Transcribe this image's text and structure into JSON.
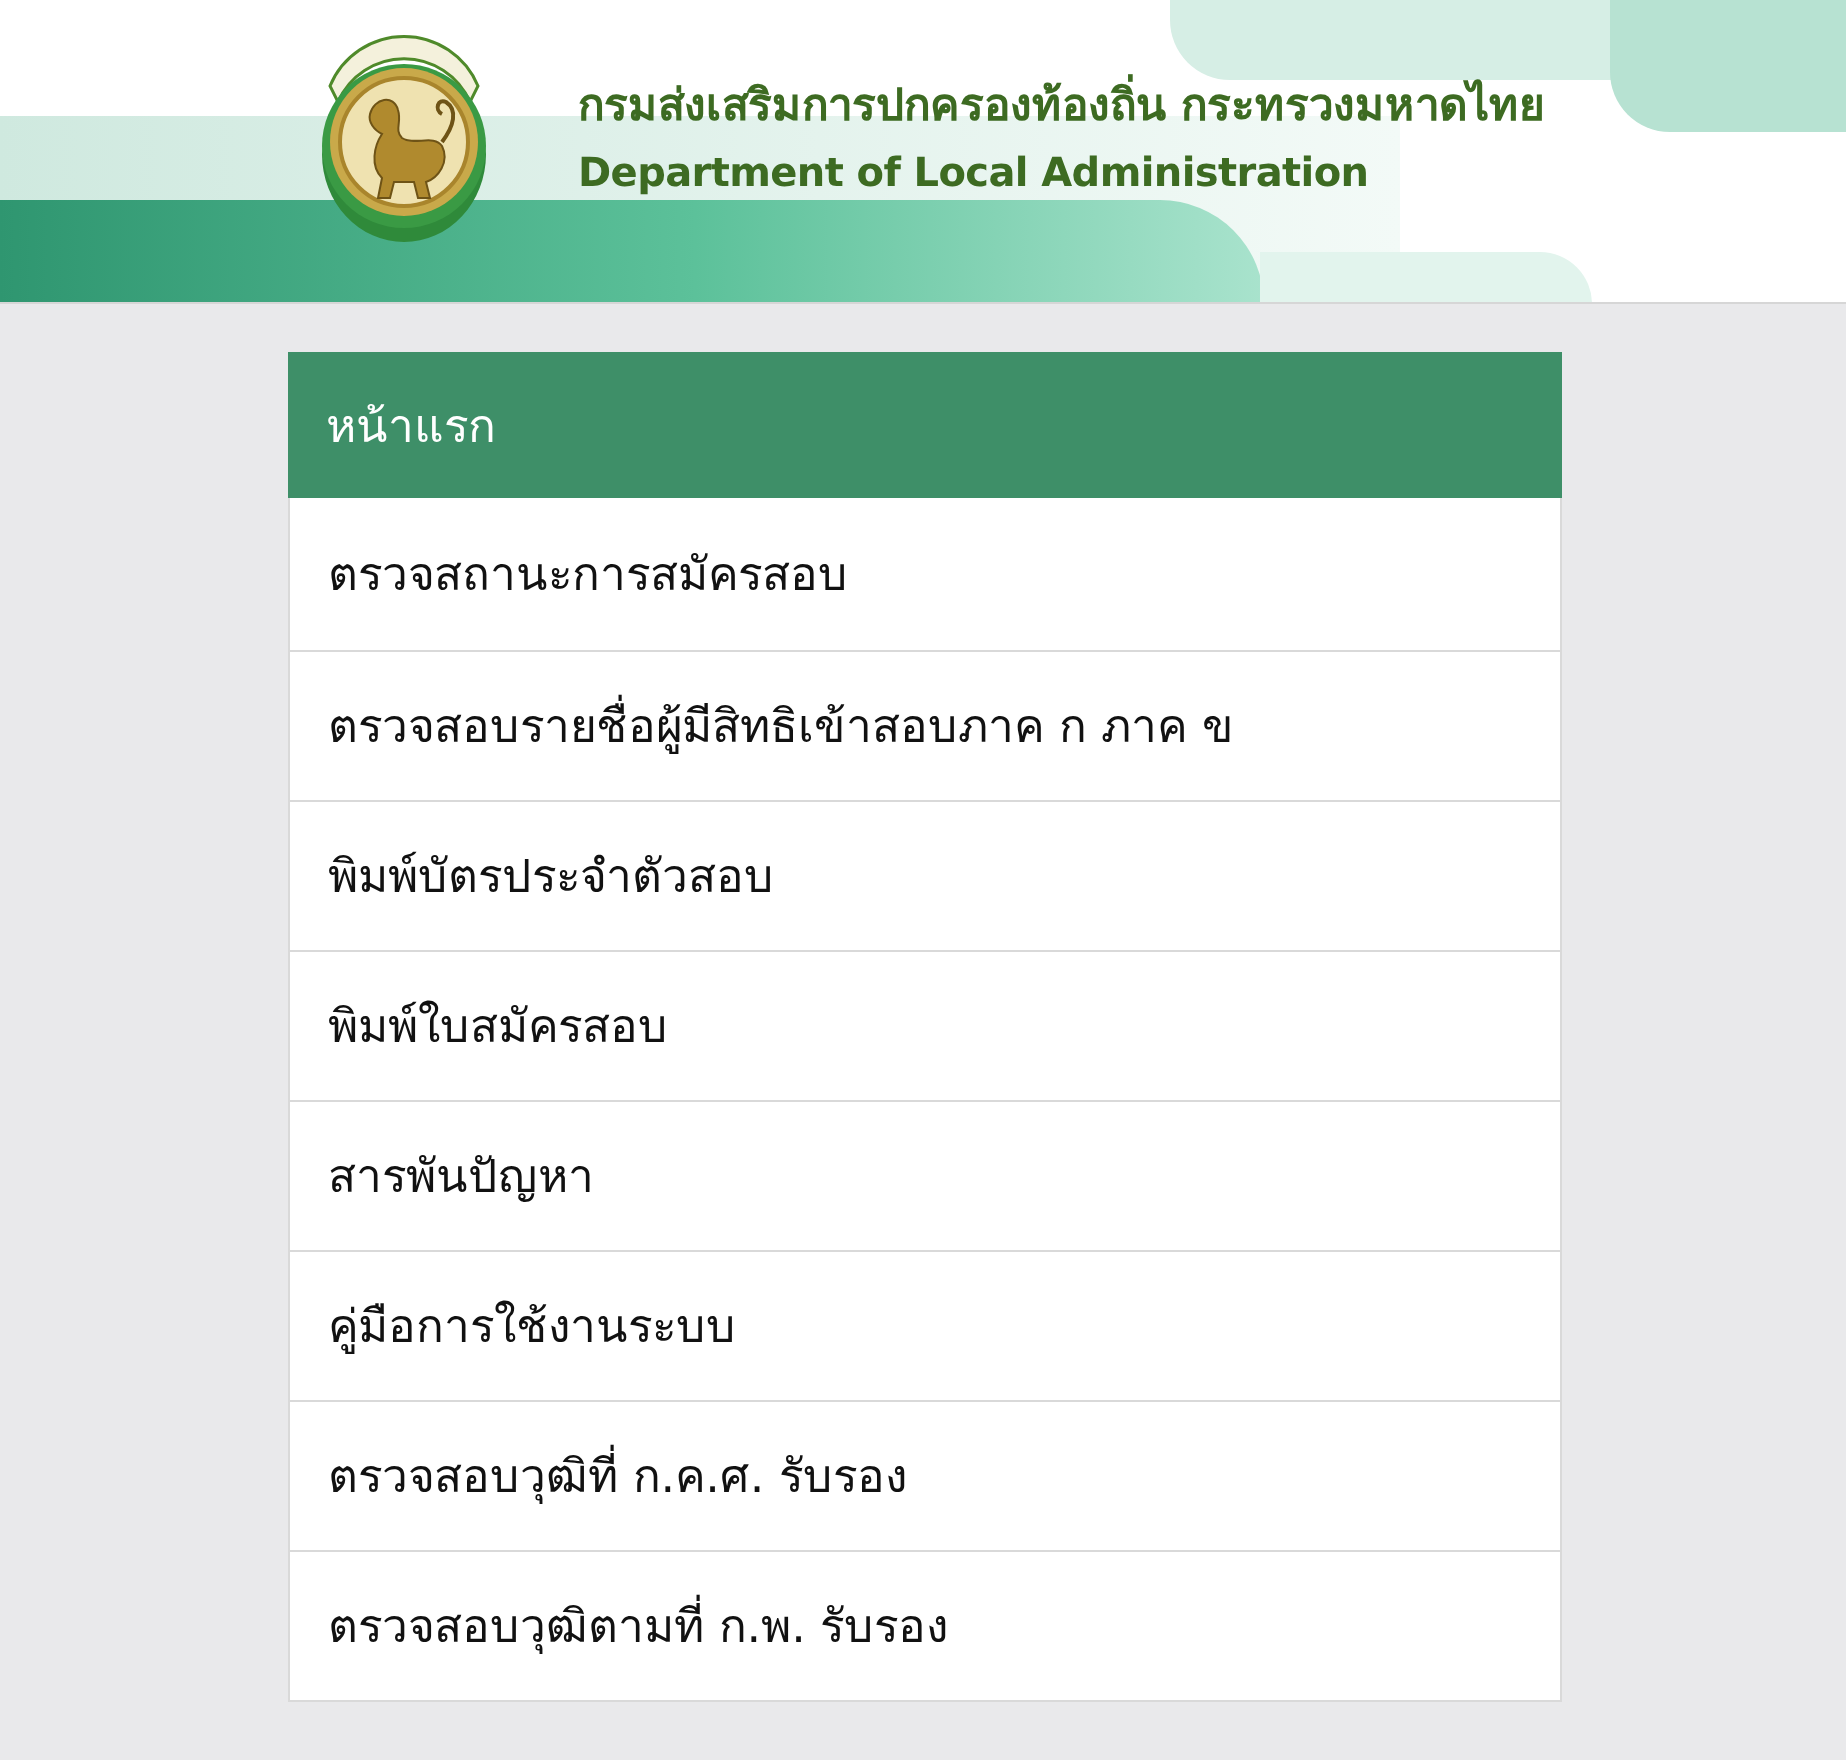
{
  "header": {
    "title_th": "กรมส่งเสริมการปกครองท้องถิ่น กระทรวงมหาดไทย",
    "title_en": "Department of Local Administration"
  },
  "menu": {
    "heading": "หน้าแรก",
    "items": [
      "ตรวจสถานะการสมัครสอบ",
      "ตรวจสอบรายชื่อผู้มีสิทธิเข้าสอบภาค ก ภาค ข",
      "พิมพ์บัตรประจำตัวสอบ",
      "พิมพ์ใบสมัครสอบ",
      "สารพันปัญหา",
      "คู่มือการใช้งานระบบ",
      "ตรวจสอบวุฒิที่ ก.ค.ศ. รับรอง",
      "ตรวจสอบวุฒิตามที่ ก.พ. รับรอง"
    ]
  }
}
